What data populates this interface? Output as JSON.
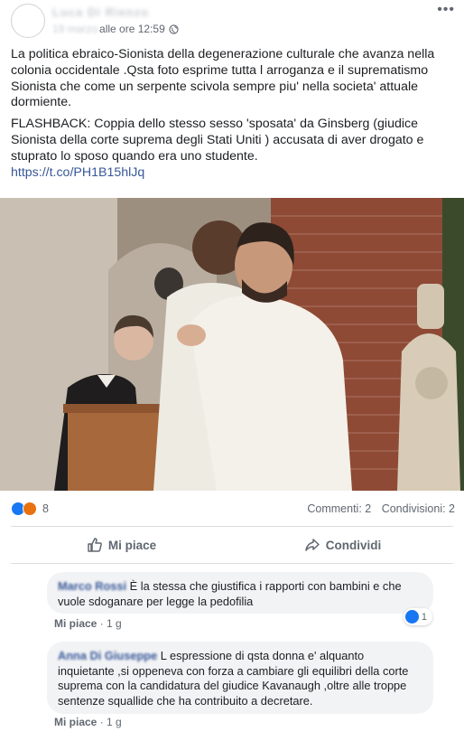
{
  "post": {
    "author_name": "Luca Di Rienzo",
    "time_prefix": "19 marzo",
    "time": "alle ore 12:59",
    "more_label": "•••",
    "paragraph1": "La politica ebraico-Sionista della degenerazione culturale che avanza nella colonia occidentale .Qsta foto esprime tutta l arroganza e il suprematismo Sionista che come un serpente scivola sempre piu' nella societa' attuale dormiente.",
    "paragraph2": "FLASHBACK: Coppia dello stesso sesso 'sposata' da Ginsberg (giudice Sionista della corte suprema degli Stati Uniti ) accusata di aver drogato e stuprato lo sposo quando era uno studente.",
    "link": "https://t.co/PH1B15hlJq"
  },
  "stats": {
    "reaction_count": "8",
    "comments": "Commenti: 2",
    "shares": "Condivisioni: 2"
  },
  "actions": {
    "like_label": "Mi piace",
    "share_label": "Condividi"
  },
  "comments": [
    {
      "author": "Marco Rossi",
      "text": "È la stessa che giustifica i rapporti con bambini e che vuole sdoganare per legge la pedofilia",
      "like_label": "Mi piace",
      "time": "1 g",
      "reaction_count": "1"
    },
    {
      "author": "Anna Di Giuseppe",
      "text": "L espressione di qsta donna e' alquanto inquietante ,si oppeneva con forza a cambiare gli equilibri della corte suprema con la candidatura del giudice Kavanaugh ,oltre alle troppe sentenze squallide che ha contribuito a decretare.",
      "like_label": "Mi piace",
      "time": "1 g"
    }
  ],
  "colors": {
    "link": "#385898",
    "like_reaction": "#1877f2",
    "angry_reaction": "#e9710f",
    "bubble": "#f2f3f5"
  }
}
